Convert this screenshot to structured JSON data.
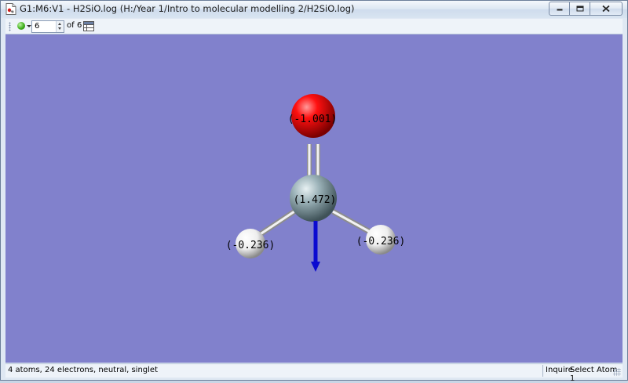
{
  "window": {
    "title": "G1:M6:V1 - H2SiO.log (H:/Year 1/Intro to molecular modelling 2/H2SiO.log)",
    "icon": "document-icon",
    "controls": [
      "minimize-icon",
      "maximize-icon",
      "close-icon"
    ]
  },
  "toolbar": {
    "structure_value": "6",
    "of_label": "of",
    "total": "6"
  },
  "molecule": {
    "atoms": [
      {
        "id": "O",
        "charge": "(-1.001)",
        "color": "#ff0000"
      },
      {
        "id": "Si",
        "charge": "(1.472)",
        "color": "#8fa6ad"
      },
      {
        "id": "H1",
        "charge": "(-0.236)",
        "color": "#ffffff"
      },
      {
        "id": "H2",
        "charge": "(-0.236)",
        "color": "#ffffff"
      }
    ],
    "bonds": [
      [
        "Si",
        "O",
        2
      ],
      [
        "Si",
        "H1",
        1
      ],
      [
        "Si",
        "H2",
        1
      ]
    ],
    "dipole_color": "#0b0bd0",
    "background": "#8181cc"
  },
  "status": {
    "summary": "4 atoms, 24 electrons, neutral, singlet",
    "mode": "Inquire",
    "prompt": "Select Atom 1"
  }
}
